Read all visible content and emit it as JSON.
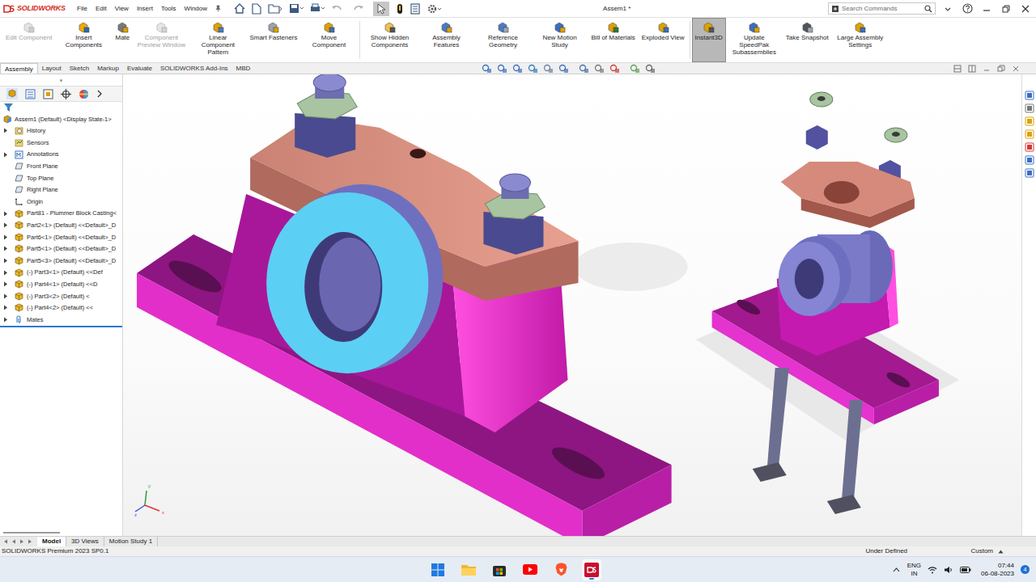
{
  "app": {
    "logo": "SOLIDWORKS",
    "menus": [
      "File",
      "Edit",
      "View",
      "Insert",
      "Tools",
      "Window"
    ],
    "title": "Assem1 *",
    "search": {
      "placeholder": "Search Commands"
    }
  },
  "ribbon": [
    {
      "label": "Edit Component",
      "disabled": true,
      "selected": false
    },
    {
      "label": "Insert Components",
      "disabled": false,
      "selected": false
    },
    {
      "label": "Mate",
      "disabled": false,
      "selected": false
    },
    {
      "label": "Component Preview Window",
      "disabled": true,
      "selected": false
    },
    {
      "label": "Linear Component Pattern",
      "disabled": false,
      "selected": false
    },
    {
      "label": "Smart Fasteners",
      "disabled": false,
      "selected": false
    },
    {
      "label": "Move Component",
      "disabled": false,
      "selected": false
    },
    {
      "label": "Show Hidden Components",
      "disabled": false,
      "selected": false
    },
    {
      "label": "Assembly Features",
      "disabled": false,
      "selected": false
    },
    {
      "label": "Reference Geometry",
      "disabled": false,
      "selected": false
    },
    {
      "label": "New Motion Study",
      "disabled": false,
      "selected": false
    },
    {
      "label": "Bill of Materials",
      "disabled": false,
      "selected": false
    },
    {
      "label": "Exploded View",
      "disabled": false,
      "selected": false
    },
    {
      "label": "Instant3D",
      "disabled": false,
      "selected": true
    },
    {
      "label": "Update SpeedPak Subassemblies",
      "disabled": false,
      "selected": false
    },
    {
      "label": "Take Snapshot",
      "disabled": false,
      "selected": false
    },
    {
      "label": "Large Assembly Settings",
      "disabled": false,
      "selected": false
    }
  ],
  "tabs": [
    {
      "label": "Assembly",
      "selected": true
    },
    {
      "label": "Layout",
      "selected": false
    },
    {
      "label": "Sketch",
      "selected": false
    },
    {
      "label": "Markup",
      "selected": false
    },
    {
      "label": "Evaluate",
      "selected": false
    },
    {
      "label": "SOLIDWORKS Add-Ins",
      "selected": false
    },
    {
      "label": "MBD",
      "selected": false
    }
  ],
  "tree": {
    "root": "Assem1 (Default) <Display State-1>",
    "items": [
      {
        "label": "History",
        "kind": "history",
        "expandable": true
      },
      {
        "label": "Sensors",
        "kind": "sensors",
        "expandable": false
      },
      {
        "label": "Annotations",
        "kind": "annotations",
        "expandable": true
      },
      {
        "label": "Front Plane",
        "kind": "plane",
        "expandable": false
      },
      {
        "label": "Top Plane",
        "kind": "plane",
        "expandable": false
      },
      {
        "label": "Right Plane",
        "kind": "plane",
        "expandable": false
      },
      {
        "label": "Origin",
        "kind": "origin",
        "expandable": false
      },
      {
        "label": "Part81 - Plummer Block Casting<",
        "kind": "part",
        "expandable": true
      },
      {
        "label": "Part2<1> (Default) <<Default>_D",
        "kind": "part",
        "expandable": true
      },
      {
        "label": "Part6<1> (Default) <<Default>_D",
        "kind": "part",
        "expandable": true
      },
      {
        "label": "Part5<1> (Default) <<Default>_D",
        "kind": "part",
        "expandable": true
      },
      {
        "label": "Part5<3> (Default) <<Default>_D",
        "kind": "part",
        "expandable": true
      },
      {
        "label": "(-) Part3<1> (Default) <<Def",
        "kind": "part",
        "expandable": true
      },
      {
        "label": "(-) Part4<1> (Default) <<D",
        "kind": "part",
        "expandable": true
      },
      {
        "label": "(-) Part3<2> (Default) <",
        "kind": "part",
        "expandable": true
      },
      {
        "label": "(-) Part4<2> (Default) <<",
        "kind": "part",
        "expandable": true
      },
      {
        "label": "Mates",
        "kind": "mates",
        "expandable": true
      }
    ]
  },
  "triad": {
    "y": "y",
    "x": "x",
    "z": "z"
  },
  "bottom_tabs": [
    {
      "label": "Model",
      "selected": true
    },
    {
      "label": "3D Views",
      "selected": false
    },
    {
      "label": "Motion Study 1",
      "selected": false
    }
  ],
  "status_bar": {
    "product": "SOLIDWORKS Premium 2023 SP0.1",
    "state": "Under Defined",
    "units": "Custom"
  },
  "taskbar": {
    "language": "ENG",
    "region": "IN",
    "time": "07:44",
    "date": "06-08-2023",
    "notifications": "4"
  }
}
